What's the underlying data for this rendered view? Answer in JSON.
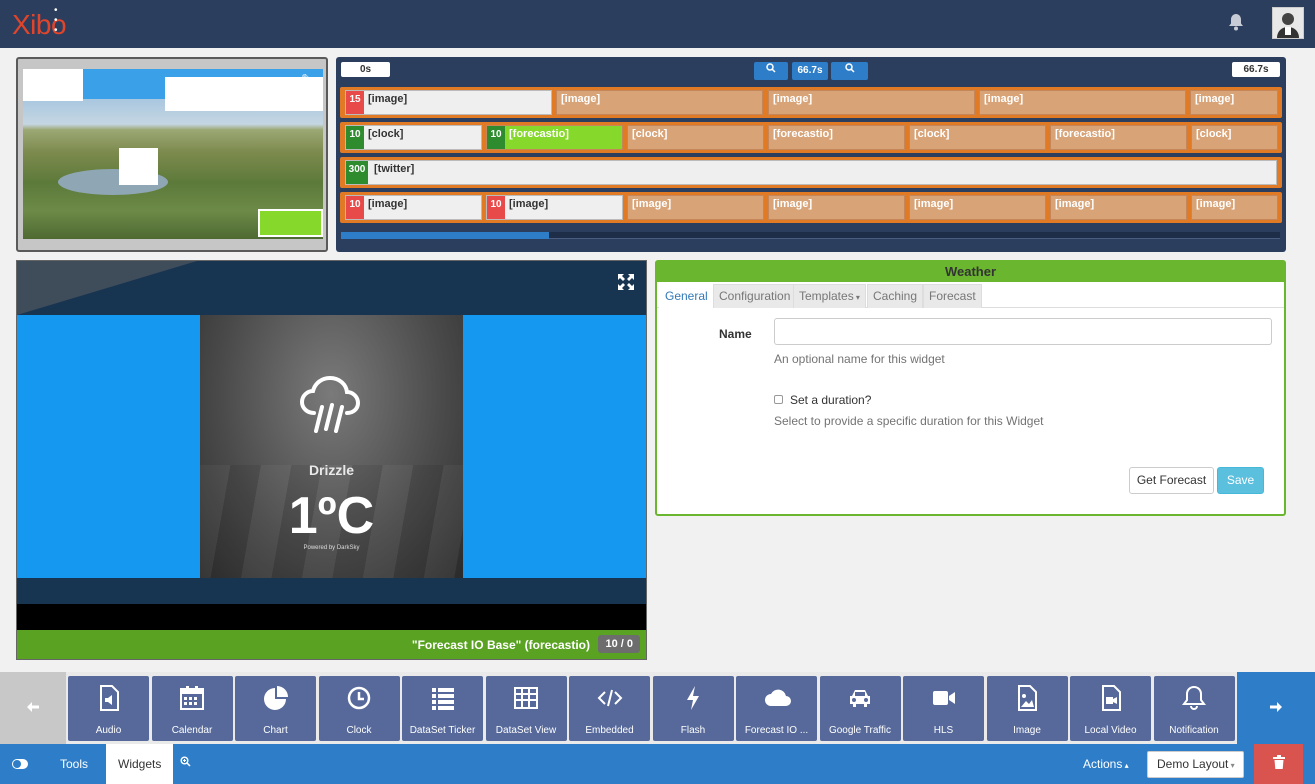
{
  "header": {
    "logo_text": "Xibo",
    "logo_dots": "• • •"
  },
  "timeline": {
    "start_badge": "0s",
    "zoom_level": "66.7s",
    "end_badge": "66.7s",
    "rows": [
      {
        "segments": [
          {
            "num": "15",
            "numcolor": "red",
            "label": "[image]",
            "state": "selected"
          },
          {
            "label": "[image]"
          },
          {
            "label": "[image]"
          },
          {
            "label": "[image]"
          },
          {
            "label": "[image]"
          }
        ]
      },
      {
        "segments": [
          {
            "num": "10",
            "numcolor": "green",
            "label": "[clock]",
            "state": "selected"
          },
          {
            "num": "10",
            "numcolor": "green",
            "label": "[forecastio]",
            "state": "lime"
          },
          {
            "label": "[clock]"
          },
          {
            "label": "[forecastio]"
          },
          {
            "label": "[clock]"
          },
          {
            "label": "[forecastio]"
          },
          {
            "label": "[clock]"
          }
        ]
      },
      {
        "segments": [
          {
            "num": "300",
            "numcolor": "green",
            "label": "[twitter]",
            "state": "selected"
          }
        ]
      },
      {
        "segments": [
          {
            "num": "10",
            "numcolor": "red",
            "label": "[image]",
            "state": "selected"
          },
          {
            "num": "10",
            "numcolor": "red",
            "label": "[image]",
            "state": "selected"
          },
          {
            "label": "[image]"
          },
          {
            "label": "[image]"
          },
          {
            "label": "[image]"
          },
          {
            "label": "[image]"
          },
          {
            "label": "[image]"
          }
        ]
      }
    ]
  },
  "preview": {
    "weather_summary": "Drizzle",
    "temperature": "1ºC",
    "powered_by": "Powered by DarkSky",
    "footer_label": "\"Forecast IO Base\" (forecastio)",
    "footer_count": "10 / 0"
  },
  "panel": {
    "title": "Weather",
    "tabs": [
      "General",
      "Configuration",
      "Templates",
      "Caching",
      "Forecast"
    ],
    "active_tab": "General",
    "name_label": "Name",
    "name_value": "",
    "name_help": "An optional name for this widget",
    "duration_label": "Set a duration?",
    "duration_checked": false,
    "duration_help": "Select to provide a specific duration for this Widget",
    "get_forecast_label": "Get Forecast",
    "save_label": "Save"
  },
  "widgets": [
    {
      "label": "Audio",
      "icon": "audio-file-icon"
    },
    {
      "label": "Calendar",
      "icon": "calendar-icon"
    },
    {
      "label": "Chart",
      "icon": "pie-chart-icon"
    },
    {
      "label": "Clock",
      "icon": "clock-icon"
    },
    {
      "label": "DataSet Ticker",
      "icon": "list-icon"
    },
    {
      "label": "DataSet View",
      "icon": "table-icon"
    },
    {
      "label": "Embedded",
      "icon": "code-icon"
    },
    {
      "label": "Flash",
      "icon": "bolt-icon"
    },
    {
      "label": "Forecast IO ...",
      "icon": "cloud-icon"
    },
    {
      "label": "Google Traffic",
      "icon": "car-icon"
    },
    {
      "label": "HLS",
      "icon": "video-camera-icon"
    },
    {
      "label": "Image",
      "icon": "image-file-icon"
    },
    {
      "label": "Local Video",
      "icon": "video-file-icon"
    },
    {
      "label": "Notification",
      "icon": "bell-icon"
    }
  ],
  "bottombar": {
    "tools_label": "Tools",
    "widgets_label": "Widgets",
    "actions_label": "Actions",
    "layout_name": "Demo Layout"
  },
  "colors": {
    "topbar": "#2c3e5e",
    "accent_blue": "#2d7dc8",
    "panel_green": "#6ab62e",
    "timeline_orange": "#e07a24",
    "widget_tile": "#56699a",
    "delete_red": "#d9534f"
  }
}
